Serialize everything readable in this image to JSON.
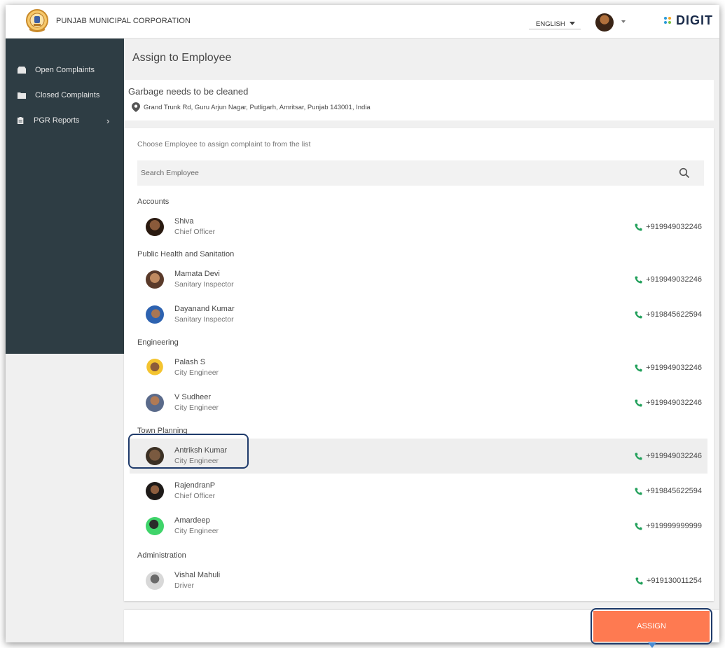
{
  "header": {
    "org_name": "PUNJAB MUNICIPAL CORPORATION",
    "language": "ENGLISH",
    "brand": "DIGIT"
  },
  "sidebar": {
    "items": [
      {
        "label": "Open Complaints",
        "icon": "inbox-icon"
      },
      {
        "label": "Closed Complaints",
        "icon": "folder-icon"
      },
      {
        "label": "PGR Reports",
        "icon": "clipboard-icon"
      }
    ]
  },
  "page": {
    "title": "Assign to Employee"
  },
  "complaint": {
    "title": "Garbage needs to be cleaned",
    "address": "Grand Trunk Rd, Guru Arjun Nagar, Putligarh, Amritsar, Punjab 143001, India"
  },
  "employee_list": {
    "instruction": "Choose Employee to assign complaint to from the list",
    "search_placeholder": "Search Employee",
    "groups": [
      {
        "name": "Accounts",
        "employees": [
          {
            "name": "Shiva",
            "role": "Chief Officer",
            "phone": "+919949032246"
          }
        ]
      },
      {
        "name": "Public Health and Sanitation",
        "employees": [
          {
            "name": "Mamata Devi",
            "role": "Sanitary Inspector",
            "phone": "+919949032246"
          },
          {
            "name": "Dayanand Kumar",
            "role": "Sanitary Inspector",
            "phone": "+919845622594"
          }
        ]
      },
      {
        "name": "Engineering",
        "employees": [
          {
            "name": "Palash S",
            "role": "City Engineer",
            "phone": "+919949032246"
          },
          {
            "name": "V Sudheer",
            "role": "City Engineer",
            "phone": "+919949032246"
          }
        ]
      },
      {
        "name": "Town Planning",
        "employees": [
          {
            "name": "Antriksh Kumar",
            "role": "City Engineer",
            "phone": "+919949032246",
            "selected": true
          },
          {
            "name": "RajendranP",
            "role": "Chief Officer",
            "phone": "+919845622594"
          },
          {
            "name": "Amardeep",
            "role": "City Engineer",
            "phone": "+919999999999"
          }
        ]
      },
      {
        "name": "Administration",
        "employees": [
          {
            "name": "Vishal Mahuli",
            "role": "Driver",
            "phone": "+919130011254"
          }
        ]
      }
    ]
  },
  "actions": {
    "assign_label": "ASSIGN",
    "accent_color": "#fe7a51"
  },
  "colors": {
    "sidebar_bg": "#2e3d44",
    "phone_icon": "#22a05b",
    "highlight_border": "#1f3b6b"
  }
}
